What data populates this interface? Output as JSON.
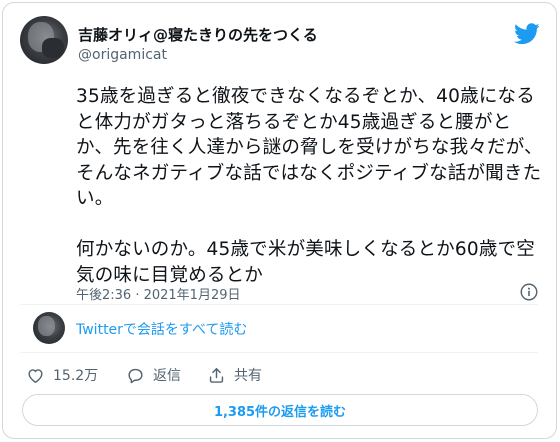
{
  "user": {
    "display_name": "吉藤オリィ@寝たきりの先をつくる",
    "handle": "@origamicat"
  },
  "tweet": {
    "text": "35歳を過ぎると徹夜できなくなるぞとか、40歳になると体力がガタっと落ちるぞとか45歳過ぎると腰がとか、先を往く人達から謎の脅しを受けがちな我々だが、そんなネガティブな話ではなくポジティブな話が聞きたい。\n\n何かないのか。45歳で米が美味しくなるとか60歳で空気の味に目覚めるとか",
    "timestamp": "午後2:36 · 2021年1月29日"
  },
  "conversation": {
    "link_label": "Twitterで会話をすべて読む"
  },
  "actions": {
    "likes": "15.2万",
    "reply_label": "返信",
    "share_label": "共有"
  },
  "replies_button": {
    "label": "1,385件の返信を読む"
  },
  "icons": {
    "brand": "twitter-bird-icon",
    "info": "info-icon",
    "like": "heart-icon",
    "reply": "speech-bubble-icon",
    "share": "upload-icon"
  },
  "colors": {
    "accent": "#1d9bf0",
    "text": "#0f1419",
    "muted": "#536471",
    "border": "#cfd9de"
  }
}
